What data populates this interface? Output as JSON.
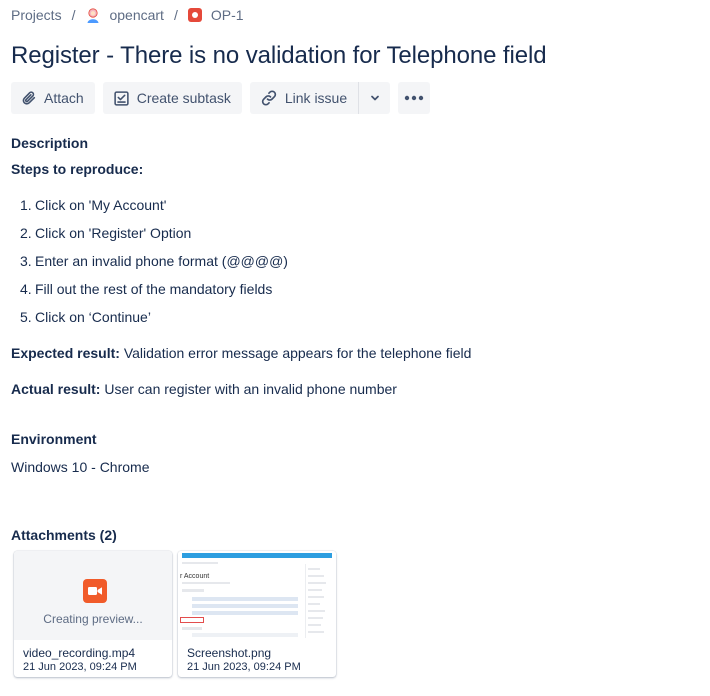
{
  "breadcrumb": {
    "projects": "Projects",
    "separator": "/",
    "project_name": "opencart",
    "issue_key": "OP-1"
  },
  "issue": {
    "title": "Register - There is no validation for Telephone field"
  },
  "toolbar": {
    "attach": "Attach",
    "create_subtask": "Create subtask",
    "link_issue": "Link issue"
  },
  "description": {
    "heading": "Description",
    "steps_heading": "Steps to reproduce:",
    "steps": [
      {
        "num": "1.",
        "text": "Click on 'My Account'"
      },
      {
        "num": "2.",
        "text": "Click on 'Register' Option"
      },
      {
        "num": "3.",
        "text": "Enter an invalid phone format (@@@@)"
      },
      {
        "num": "4.",
        "text": "Fill out the rest of the mandatory fields"
      },
      {
        "num": "5.",
        "text": "Click on ‘Continue’"
      }
    ],
    "expected_label": "Expected result:",
    "expected_text": "Validation error message appears for the telephone field",
    "actual_label": "Actual result:",
    "actual_text": "User can register with an invalid phone number"
  },
  "environment": {
    "heading": "Environment",
    "value": "Windows 10 - Chrome"
  },
  "attachments": {
    "heading": "Attachments (2)",
    "items": [
      {
        "name": "video_recording.mp4",
        "date": "21 Jun 2023, 09:24 PM",
        "preview": "Creating preview..."
      },
      {
        "name": "Screenshot.png",
        "date": "21 Jun 2023, 09:24 PM"
      }
    ]
  },
  "icons": {
    "attach": "paperclip-icon",
    "subtask": "checkbox-subtask-icon",
    "link": "link-icon",
    "chevron": "chevron-down-icon",
    "more": "more-horizontal-icon",
    "bug": "bug-icon",
    "video": "video-icon"
  },
  "colors": {
    "bug": "#e5493a",
    "video": "#f15b2a",
    "text": "#172b4d",
    "subtle": "#5e6c84",
    "button_bg": "#f4f5f7"
  }
}
